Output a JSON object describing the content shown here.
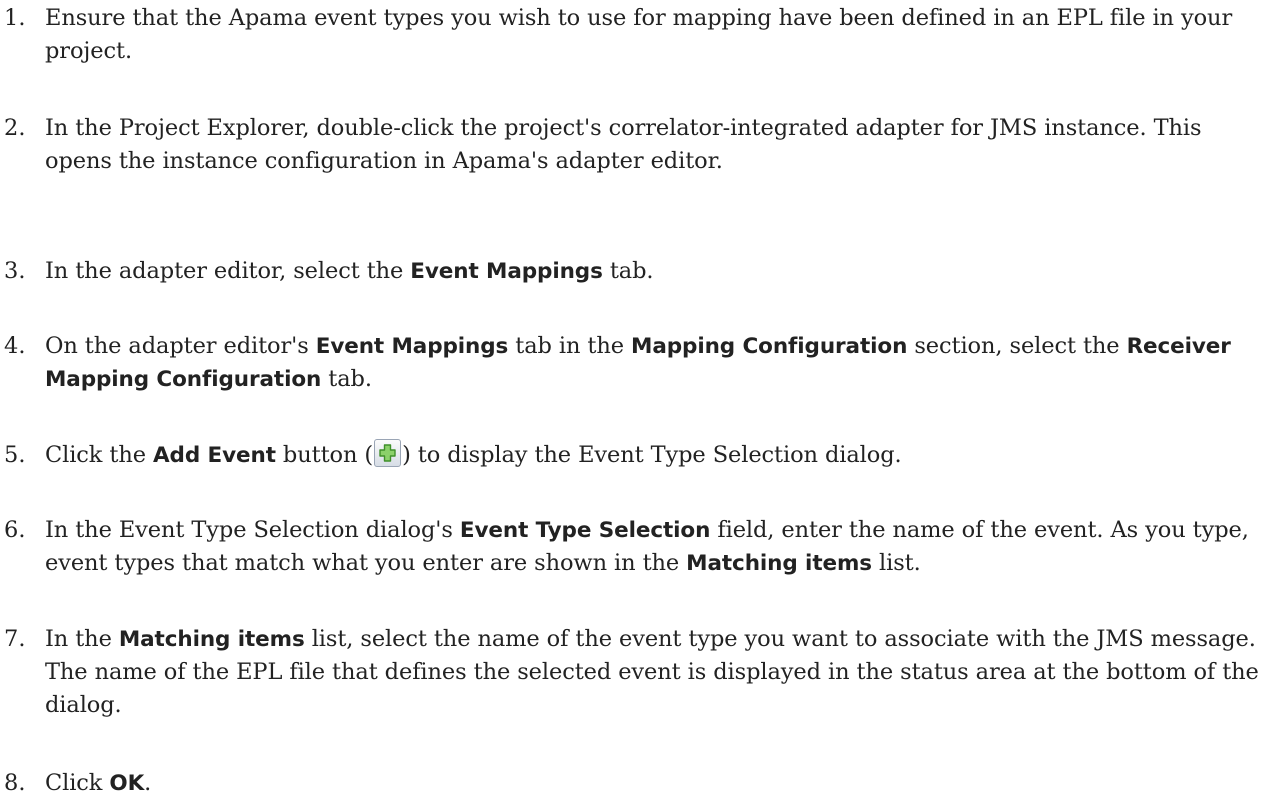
{
  "steps": [
    {
      "num": "1.",
      "parts": [
        {
          "t": "Ensure that the Apama event types you wish to use for mapping have been defined in an EPL file in your project."
        }
      ]
    },
    {
      "num": "2.",
      "parts": [
        {
          "t": "In the Project Explorer, double-click the project's correlator-integrated adapter for JMS instance. This opens the instance configuration in Apama's adapter editor."
        }
      ]
    },
    {
      "num": "3.",
      "parts": [
        {
          "t": "In the adapter editor, select the "
        },
        {
          "t": "Event Mappings",
          "b": true
        },
        {
          "t": " tab."
        }
      ]
    },
    {
      "num": "4.",
      "parts": [
        {
          "t": "On the adapter editor's "
        },
        {
          "t": "Event Mappings",
          "b": true
        },
        {
          "t": " tab in the "
        },
        {
          "t": "Mapping Configuration",
          "b": true
        },
        {
          "t": " section, select the "
        },
        {
          "t": "Receiver Mapping Configuration",
          "b": true
        },
        {
          "t": " tab."
        }
      ]
    },
    {
      "num": "5.",
      "parts": [
        {
          "t": "Click the "
        },
        {
          "t": "Add Event",
          "b": true
        },
        {
          "t": " button ("
        },
        {
          "icon": "add-event-icon"
        },
        {
          "t": ") to display the Event Type Selection dialog."
        }
      ]
    },
    {
      "num": "6.",
      "parts": [
        {
          "t": "In the Event Type Selection dialog's "
        },
        {
          "t": "Event Type Selection",
          "b": true
        },
        {
          "t": " field, enter the name of the event. As you type, event types that match what you enter are shown in the "
        },
        {
          "t": "Matching items",
          "b": true
        },
        {
          "t": " list."
        }
      ]
    },
    {
      "num": "7.",
      "parts": [
        {
          "t": "In the "
        },
        {
          "t": "Matching items",
          "b": true
        },
        {
          "t": " list, select the name of the event type you want to associate with the JMS message. The name of the EPL file that defines the selected event is displayed in the status area at the bottom of the dialog."
        }
      ]
    },
    {
      "num": "8.",
      "parts": [
        {
          "t": "Click "
        },
        {
          "t": "OK",
          "b": true
        },
        {
          "t": "."
        }
      ]
    }
  ],
  "icon_colors": {
    "plus_fill": "#8bd16a",
    "plus_stroke": "#3f8f2a"
  }
}
